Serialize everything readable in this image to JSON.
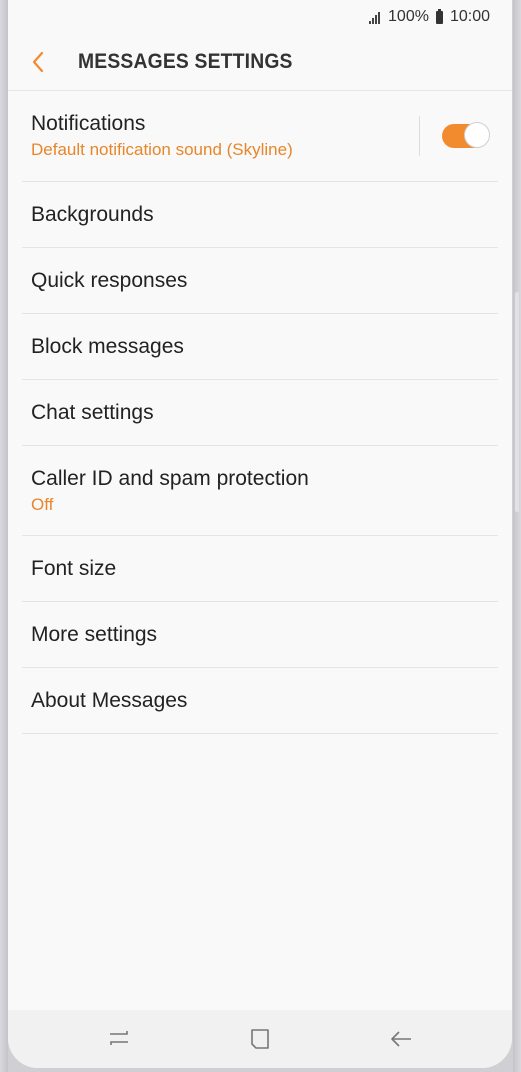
{
  "status_bar": {
    "battery": "100%",
    "time": "10:00",
    "icons": [
      "signal-icon",
      "battery-icon"
    ]
  },
  "header": {
    "title": "MESSAGES SETTINGS",
    "back_icon": "chevron-left-icon"
  },
  "colors": {
    "accent": "#f28a2e",
    "subtext": "#e8862a",
    "background": "#f9f9f9",
    "text": "#222222"
  },
  "settings": {
    "notifications": {
      "label": "Notifications",
      "sub": "Default notification sound (Skyline)",
      "toggle_on": true
    },
    "items": [
      {
        "label": "Backgrounds"
      },
      {
        "label": "Quick responses"
      },
      {
        "label": "Block messages"
      },
      {
        "label": "Chat settings"
      },
      {
        "label": "Caller ID and spam protection",
        "sub": "Off"
      },
      {
        "label": "Font size"
      },
      {
        "label": "More settings"
      },
      {
        "label": "About Messages"
      }
    ]
  },
  "nav_bar": {
    "icons": [
      "recents-icon",
      "home-icon",
      "back-icon"
    ]
  }
}
